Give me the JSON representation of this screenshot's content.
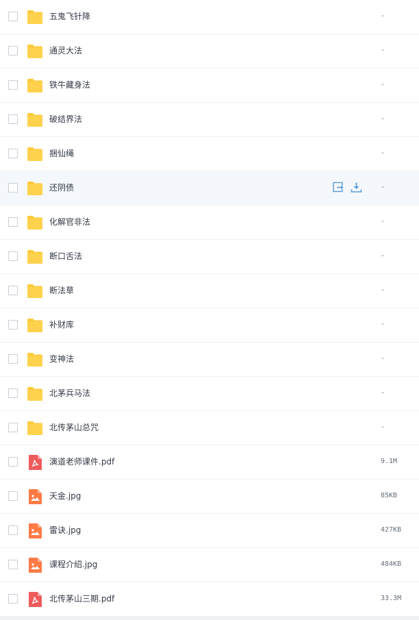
{
  "files": [
    {
      "name": "五鬼飞针降",
      "type": "folder",
      "size": "-"
    },
    {
      "name": "通灵大法",
      "type": "folder",
      "size": "-"
    },
    {
      "name": "铁牛藏身法",
      "type": "folder",
      "size": "-"
    },
    {
      "name": "破结界法",
      "type": "folder",
      "size": "-"
    },
    {
      "name": "捆仙绳",
      "type": "folder",
      "size": "-"
    },
    {
      "name": "还阴债",
      "type": "folder",
      "size": "-",
      "hovered": true
    },
    {
      "name": "化解官非法",
      "type": "folder",
      "size": "-"
    },
    {
      "name": "断口舌法",
      "type": "folder",
      "size": "-"
    },
    {
      "name": "断法草",
      "type": "folder",
      "size": "-"
    },
    {
      "name": "补财库",
      "type": "folder",
      "size": "-"
    },
    {
      "name": "变神法",
      "type": "folder",
      "size": "-"
    },
    {
      "name": "北茅兵马法",
      "type": "folder",
      "size": "-"
    },
    {
      "name": "北传茅山总咒",
      "type": "folder",
      "size": "-"
    },
    {
      "name": "演道老师课件.pdf",
      "type": "pdf",
      "size": "9.1M"
    },
    {
      "name": "天金.jpg",
      "type": "image",
      "size": "85KB"
    },
    {
      "name": "雷诀.jpg",
      "type": "image",
      "size": "427KB"
    },
    {
      "name": "课程介绍.jpg",
      "type": "image",
      "size": "484KB"
    },
    {
      "name": "北传茅山三期.pdf",
      "type": "pdf",
      "size": "33.3M"
    }
  ],
  "colors": {
    "folder": "#ffd24d",
    "folder_tab": "#ffc93a",
    "pdf": "#ef5a5a",
    "image": "#ff7a45",
    "hover_row": "#f4f8fd",
    "action_icon": "#5b9bd5"
  },
  "icons": {
    "folder": "folder-icon",
    "pdf": "pdf-file-icon",
    "image": "image-file-icon",
    "move": "move-to-icon",
    "download": "download-icon"
  }
}
